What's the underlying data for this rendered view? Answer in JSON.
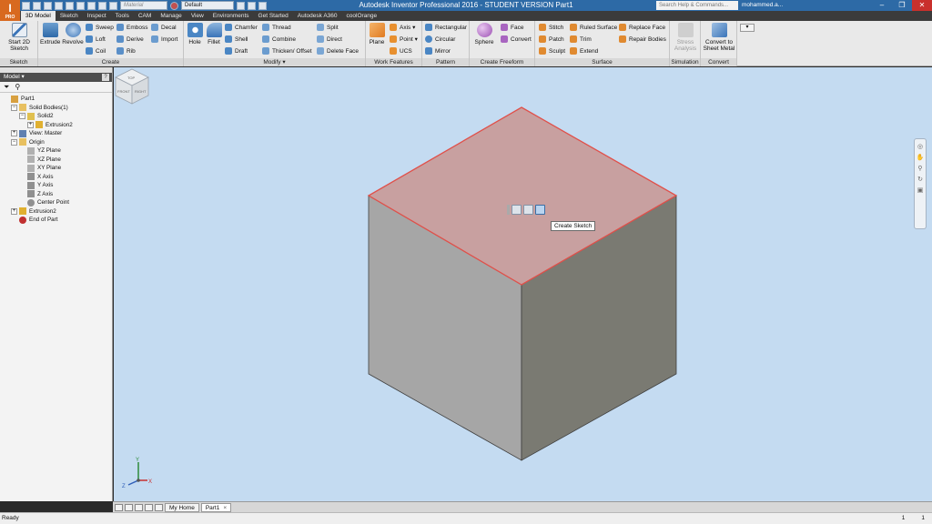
{
  "app": {
    "logo_letter": "I",
    "logo_sub": "PRO",
    "title": "Autodesk Inventor Professional 2016 - STUDENT VERSION    Part1"
  },
  "qat": {
    "material": "Material",
    "appearance": "Default"
  },
  "search": {
    "placeholder": "Search Help & Commands..."
  },
  "user": {
    "name": "mohammed.a..."
  },
  "window": {
    "min": "–",
    "max": "❐",
    "close": "✕"
  },
  "tabs": [
    "3D Model",
    "Sketch",
    "Inspect",
    "Tools",
    "CAM",
    "Manage",
    "View",
    "Environments",
    "Get Started",
    "Autodesk A360",
    "coolOrange"
  ],
  "ribbon": {
    "sketch": {
      "title": "Sketch",
      "start_sketch": "Start 2D Sketch"
    },
    "create": {
      "title": "Create",
      "extrude": "Extrude",
      "revolve": "Revolve",
      "sweep": "Sweep",
      "loft": "Loft",
      "coil": "Coil",
      "emboss": "Emboss",
      "derive": "Derive",
      "rib": "Rib",
      "decal": "Decal",
      "import": "Import"
    },
    "modify": {
      "title": "Modify ▾",
      "hole": "Hole",
      "fillet": "Fillet",
      "chamfer": "Chamfer",
      "shell": "Shell",
      "draft": "Draft",
      "thread": "Thread",
      "combine": "Combine",
      "thicken": "Thicken/ Offset",
      "split": "Split",
      "direct": "Direct",
      "delete_face": "Delete Face"
    },
    "work_features": {
      "title": "Work Features",
      "plane": "Plane",
      "axis": "Axis ▾",
      "point": "Point ▾",
      "ucs": "UCS"
    },
    "pattern": {
      "title": "Pattern",
      "rectangular": "Rectangular",
      "circular": "Circular",
      "mirror": "Mirror"
    },
    "freeform": {
      "title": "Create Freeform",
      "sphere": "Sphere",
      "face": "Face",
      "convert": "Convert"
    },
    "surface": {
      "title": "Surface",
      "stitch": "Stitch",
      "patch": "Patch",
      "sculpt": "Sculpt",
      "ruled_surface": "Ruled Surface",
      "trim": "Trim",
      "extend": "Extend",
      "replace_face": "Replace Face",
      "repair_bodies": "Repair Bodies"
    },
    "simulation": {
      "title": "Simulation",
      "stress_analysis": "Stress Analysis"
    },
    "convert": {
      "title": "Convert",
      "to_sheet_metal": "Convert to Sheet Metal"
    }
  },
  "browser": {
    "title": "Model ▾",
    "help": "?",
    "tree": [
      {
        "label": "Part1",
        "level": 0,
        "toggle": "",
        "icon": "part"
      },
      {
        "label": "Solid Bodies(1)",
        "level": 1,
        "toggle": "−",
        "icon": "folder"
      },
      {
        "label": "Solid2",
        "level": 2,
        "toggle": "−",
        "icon": "solid"
      },
      {
        "label": "Extrusion2",
        "level": 3,
        "toggle": "+",
        "icon": "feature"
      },
      {
        "label": "View: Master",
        "level": 1,
        "toggle": "+",
        "icon": "view"
      },
      {
        "label": "Origin",
        "level": 1,
        "toggle": "−",
        "icon": "folder"
      },
      {
        "label": "YZ Plane",
        "level": 2,
        "toggle": "",
        "icon": "plane"
      },
      {
        "label": "XZ Plane",
        "level": 2,
        "toggle": "",
        "icon": "plane"
      },
      {
        "label": "XY Plane",
        "level": 2,
        "toggle": "",
        "icon": "plane"
      },
      {
        "label": "X Axis",
        "level": 2,
        "toggle": "",
        "icon": "axis"
      },
      {
        "label": "Y Axis",
        "level": 2,
        "toggle": "",
        "icon": "axis"
      },
      {
        "label": "Z Axis",
        "level": 2,
        "toggle": "",
        "icon": "axis"
      },
      {
        "label": "Center Point",
        "level": 2,
        "toggle": "",
        "icon": "point"
      },
      {
        "label": "Extrusion2",
        "level": 1,
        "toggle": "+",
        "icon": "feature"
      },
      {
        "label": "End of Part",
        "level": 1,
        "toggle": "",
        "icon": "end"
      }
    ]
  },
  "viewport": {
    "tooltip": "Create Sketch",
    "triad": {
      "x": "X",
      "y": "Y",
      "z": "Z"
    },
    "viewcube": {
      "top": "TOP",
      "front": "FRONT",
      "right": "RIGHT"
    },
    "colors": {
      "background": "#c4dbf1",
      "top_face": "#c8a0a0",
      "highlight": "#e0504a",
      "left_face": "#a6a6a6",
      "right_face": "#7a7a72"
    }
  },
  "doc_tabs": {
    "home": "My Home",
    "part": "Part1"
  },
  "status": {
    "text": "Ready",
    "num1": "1",
    "num2": "1"
  }
}
